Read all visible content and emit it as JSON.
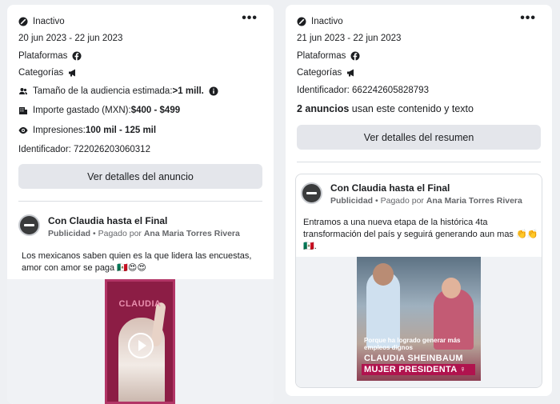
{
  "left_card": {
    "status": "Inactivo",
    "dates": "20 jun 2023 - 22 jun 2023",
    "platforms_label": "Plataformas",
    "categories_label": "Categorías",
    "audience_label": "Tamaño de la audiencia estimada:",
    "audience_value": ">1 mill.",
    "spend_label": "Importe gastado (MXN): ",
    "spend_value": "$400 - $499",
    "impressions_label": "Impresiones: ",
    "impressions_value": "100 mil - 125 mil",
    "identifier": "Identificador: 722026203060312",
    "details_button": "Ver detalles del anuncio",
    "ad": {
      "page_name": "Con Claudia hasta el Final",
      "sponsored": "Publicidad",
      "paid_by_prefix": " • Pagado por ",
      "paid_by": "Ana Maria Torres Rivera",
      "text_line1": "Los mexicanos saben quien es la que lidera las encuestas,",
      "text_line2": "amor con amor se paga 🇲🇽😍😍",
      "media_brand": "CLAUDIA"
    }
  },
  "right_card": {
    "status": "Inactivo",
    "dates": "21 jun 2023 - 22 jun 2023",
    "platforms_label": "Plataformas",
    "categories_label": "Categorías",
    "identifier": "Identificador: 662242605828793",
    "ads_count": "2 anuncios",
    "ads_count_suffix": " usan este contenido y texto",
    "details_button": "Ver detalles del resumen",
    "ad": {
      "page_name": "Con Claudia hasta el Final",
      "sponsored": "Publicidad",
      "paid_by_prefix": " • Pagado por ",
      "paid_by": "Ana Maria Torres Rivera",
      "text_line1": "Entramos a una nueva etapa de la histórica 4ta",
      "text_line2": "transformación del país y seguirá generando aun mas 👏👏",
      "text_line3": "🇲🇽.",
      "media_caption": "Porque ha logrado generar más empleos dignos",
      "media_name": "CLAUDIA SHEINBAUM",
      "media_slogan": "MUJER PRESIDENTA ♀"
    }
  },
  "icons": {
    "status": "inactive-status-icon",
    "platform": "facebook-icon",
    "category": "megaphone-icon",
    "audience": "people-icon",
    "spend": "bank-icon",
    "impressions": "eye-icon",
    "info": "info-icon",
    "more": "more-options-icon"
  },
  "colors": {
    "background": "#eef0f3",
    "card": "#ffffff",
    "button": "#e4e6eb",
    "muted_text": "#65676b",
    "brand_pink": "#b0134e"
  }
}
